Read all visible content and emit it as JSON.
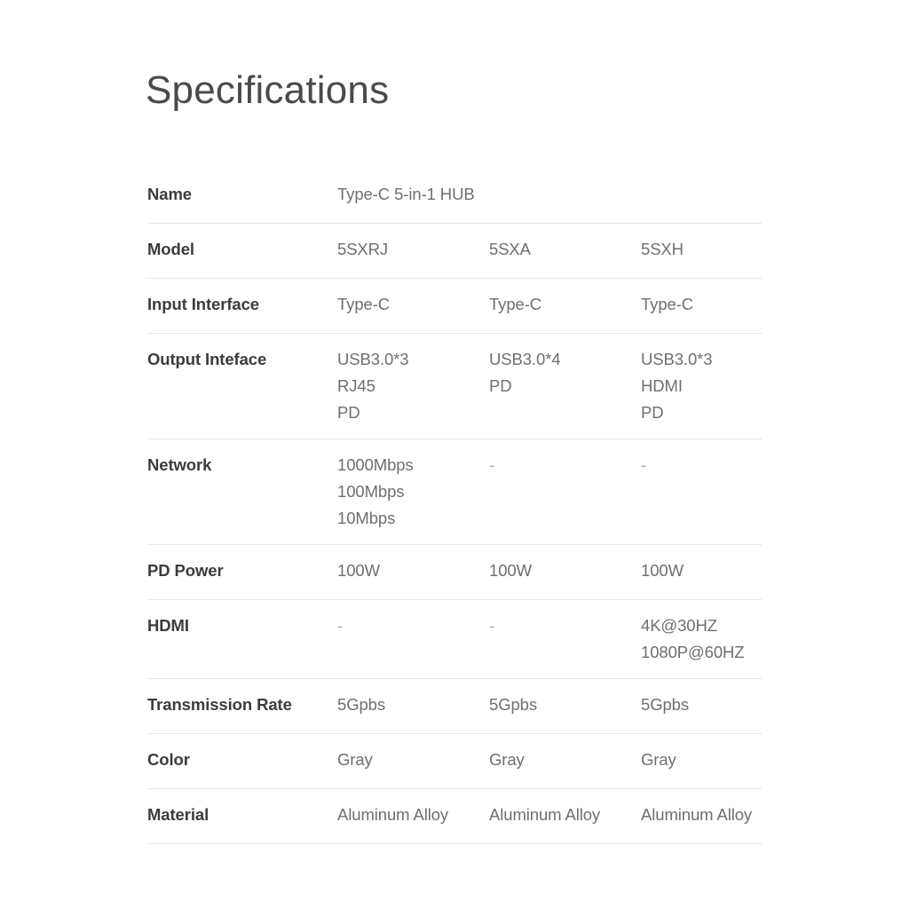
{
  "page": {
    "title": "Specifications",
    "background_color": "#ffffff",
    "label_color": "#3c3c3c",
    "value_color": "#6f6f6f",
    "divider_color": "#e6e6e6"
  },
  "table": {
    "rows": [
      {
        "label": "Name",
        "values": [
          [
            "Type-C 5-in-1 HUB"
          ],
          [],
          []
        ]
      },
      {
        "label": "Model",
        "values": [
          [
            "5SXRJ"
          ],
          [
            "5SXA"
          ],
          [
            "5SXH"
          ]
        ]
      },
      {
        "label": "Input Interface",
        "values": [
          [
            "Type-C"
          ],
          [
            "Type-C"
          ],
          [
            "Type-C"
          ]
        ]
      },
      {
        "label": "Output Inteface",
        "values": [
          [
            "USB3.0*3",
            "RJ45",
            "PD"
          ],
          [
            "USB3.0*4",
            "PD"
          ],
          [
            "USB3.0*3",
            "HDMI",
            "PD"
          ]
        ]
      },
      {
        "label": "Network",
        "values": [
          [
            "1000Mbps",
            "100Mbps",
            "10Mbps"
          ],
          [
            "-"
          ],
          [
            "-"
          ]
        ]
      },
      {
        "label": "PD Power",
        "values": [
          [
            "100W"
          ],
          [
            "100W"
          ],
          [
            "100W"
          ]
        ]
      },
      {
        "label": "HDMI",
        "values": [
          [
            "-"
          ],
          [
            "-"
          ],
          [
            "4K@30HZ",
            "1080P@60HZ"
          ]
        ]
      },
      {
        "label": "Transmission Rate",
        "values": [
          [
            "5Gpbs"
          ],
          [
            "5Gpbs"
          ],
          [
            "5Gpbs"
          ]
        ]
      },
      {
        "label": "Color",
        "values": [
          [
            "Gray"
          ],
          [
            "Gray"
          ],
          [
            "Gray"
          ]
        ]
      },
      {
        "label": "Material",
        "values": [
          [
            "Aluminum Alloy"
          ],
          [
            "Aluminum Alloy"
          ],
          [
            "Aluminum Alloy"
          ]
        ]
      }
    ]
  }
}
